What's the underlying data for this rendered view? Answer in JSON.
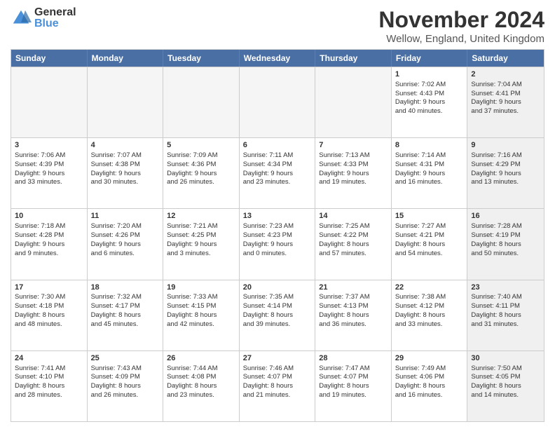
{
  "logo": {
    "general": "General",
    "blue": "Blue"
  },
  "title": "November 2024",
  "location": "Wellow, England, United Kingdom",
  "days_of_week": [
    "Sunday",
    "Monday",
    "Tuesday",
    "Wednesday",
    "Thursday",
    "Friday",
    "Saturday"
  ],
  "weeks": [
    [
      {
        "day": "",
        "info": "",
        "shaded": false,
        "empty": true
      },
      {
        "day": "",
        "info": "",
        "shaded": false,
        "empty": true
      },
      {
        "day": "",
        "info": "",
        "shaded": false,
        "empty": true
      },
      {
        "day": "",
        "info": "",
        "shaded": false,
        "empty": true
      },
      {
        "day": "",
        "info": "",
        "shaded": false,
        "empty": true
      },
      {
        "day": "1",
        "info": "Sunrise: 7:02 AM\nSunset: 4:43 PM\nDaylight: 9 hours\nand 40 minutes.",
        "shaded": false,
        "empty": false
      },
      {
        "day": "2",
        "info": "Sunrise: 7:04 AM\nSunset: 4:41 PM\nDaylight: 9 hours\nand 37 minutes.",
        "shaded": true,
        "empty": false
      }
    ],
    [
      {
        "day": "3",
        "info": "Sunrise: 7:06 AM\nSunset: 4:39 PM\nDaylight: 9 hours\nand 33 minutes.",
        "shaded": false,
        "empty": false
      },
      {
        "day": "4",
        "info": "Sunrise: 7:07 AM\nSunset: 4:38 PM\nDaylight: 9 hours\nand 30 minutes.",
        "shaded": false,
        "empty": false
      },
      {
        "day": "5",
        "info": "Sunrise: 7:09 AM\nSunset: 4:36 PM\nDaylight: 9 hours\nand 26 minutes.",
        "shaded": false,
        "empty": false
      },
      {
        "day": "6",
        "info": "Sunrise: 7:11 AM\nSunset: 4:34 PM\nDaylight: 9 hours\nand 23 minutes.",
        "shaded": false,
        "empty": false
      },
      {
        "day": "7",
        "info": "Sunrise: 7:13 AM\nSunset: 4:33 PM\nDaylight: 9 hours\nand 19 minutes.",
        "shaded": false,
        "empty": false
      },
      {
        "day": "8",
        "info": "Sunrise: 7:14 AM\nSunset: 4:31 PM\nDaylight: 9 hours\nand 16 minutes.",
        "shaded": false,
        "empty": false
      },
      {
        "day": "9",
        "info": "Sunrise: 7:16 AM\nSunset: 4:29 PM\nDaylight: 9 hours\nand 13 minutes.",
        "shaded": true,
        "empty": false
      }
    ],
    [
      {
        "day": "10",
        "info": "Sunrise: 7:18 AM\nSunset: 4:28 PM\nDaylight: 9 hours\nand 9 minutes.",
        "shaded": false,
        "empty": false
      },
      {
        "day": "11",
        "info": "Sunrise: 7:20 AM\nSunset: 4:26 PM\nDaylight: 9 hours\nand 6 minutes.",
        "shaded": false,
        "empty": false
      },
      {
        "day": "12",
        "info": "Sunrise: 7:21 AM\nSunset: 4:25 PM\nDaylight: 9 hours\nand 3 minutes.",
        "shaded": false,
        "empty": false
      },
      {
        "day": "13",
        "info": "Sunrise: 7:23 AM\nSunset: 4:23 PM\nDaylight: 9 hours\nand 0 minutes.",
        "shaded": false,
        "empty": false
      },
      {
        "day": "14",
        "info": "Sunrise: 7:25 AM\nSunset: 4:22 PM\nDaylight: 8 hours\nand 57 minutes.",
        "shaded": false,
        "empty": false
      },
      {
        "day": "15",
        "info": "Sunrise: 7:27 AM\nSunset: 4:21 PM\nDaylight: 8 hours\nand 54 minutes.",
        "shaded": false,
        "empty": false
      },
      {
        "day": "16",
        "info": "Sunrise: 7:28 AM\nSunset: 4:19 PM\nDaylight: 8 hours\nand 50 minutes.",
        "shaded": true,
        "empty": false
      }
    ],
    [
      {
        "day": "17",
        "info": "Sunrise: 7:30 AM\nSunset: 4:18 PM\nDaylight: 8 hours\nand 48 minutes.",
        "shaded": false,
        "empty": false
      },
      {
        "day": "18",
        "info": "Sunrise: 7:32 AM\nSunset: 4:17 PM\nDaylight: 8 hours\nand 45 minutes.",
        "shaded": false,
        "empty": false
      },
      {
        "day": "19",
        "info": "Sunrise: 7:33 AM\nSunset: 4:15 PM\nDaylight: 8 hours\nand 42 minutes.",
        "shaded": false,
        "empty": false
      },
      {
        "day": "20",
        "info": "Sunrise: 7:35 AM\nSunset: 4:14 PM\nDaylight: 8 hours\nand 39 minutes.",
        "shaded": false,
        "empty": false
      },
      {
        "day": "21",
        "info": "Sunrise: 7:37 AM\nSunset: 4:13 PM\nDaylight: 8 hours\nand 36 minutes.",
        "shaded": false,
        "empty": false
      },
      {
        "day": "22",
        "info": "Sunrise: 7:38 AM\nSunset: 4:12 PM\nDaylight: 8 hours\nand 33 minutes.",
        "shaded": false,
        "empty": false
      },
      {
        "day": "23",
        "info": "Sunrise: 7:40 AM\nSunset: 4:11 PM\nDaylight: 8 hours\nand 31 minutes.",
        "shaded": true,
        "empty": false
      }
    ],
    [
      {
        "day": "24",
        "info": "Sunrise: 7:41 AM\nSunset: 4:10 PM\nDaylight: 8 hours\nand 28 minutes.",
        "shaded": false,
        "empty": false
      },
      {
        "day": "25",
        "info": "Sunrise: 7:43 AM\nSunset: 4:09 PM\nDaylight: 8 hours\nand 26 minutes.",
        "shaded": false,
        "empty": false
      },
      {
        "day": "26",
        "info": "Sunrise: 7:44 AM\nSunset: 4:08 PM\nDaylight: 8 hours\nand 23 minutes.",
        "shaded": false,
        "empty": false
      },
      {
        "day": "27",
        "info": "Sunrise: 7:46 AM\nSunset: 4:07 PM\nDaylight: 8 hours\nand 21 minutes.",
        "shaded": false,
        "empty": false
      },
      {
        "day": "28",
        "info": "Sunrise: 7:47 AM\nSunset: 4:07 PM\nDaylight: 8 hours\nand 19 minutes.",
        "shaded": false,
        "empty": false
      },
      {
        "day": "29",
        "info": "Sunrise: 7:49 AM\nSunset: 4:06 PM\nDaylight: 8 hours\nand 16 minutes.",
        "shaded": false,
        "empty": false
      },
      {
        "day": "30",
        "info": "Sunrise: 7:50 AM\nSunset: 4:05 PM\nDaylight: 8 hours\nand 14 minutes.",
        "shaded": true,
        "empty": false
      }
    ]
  ]
}
